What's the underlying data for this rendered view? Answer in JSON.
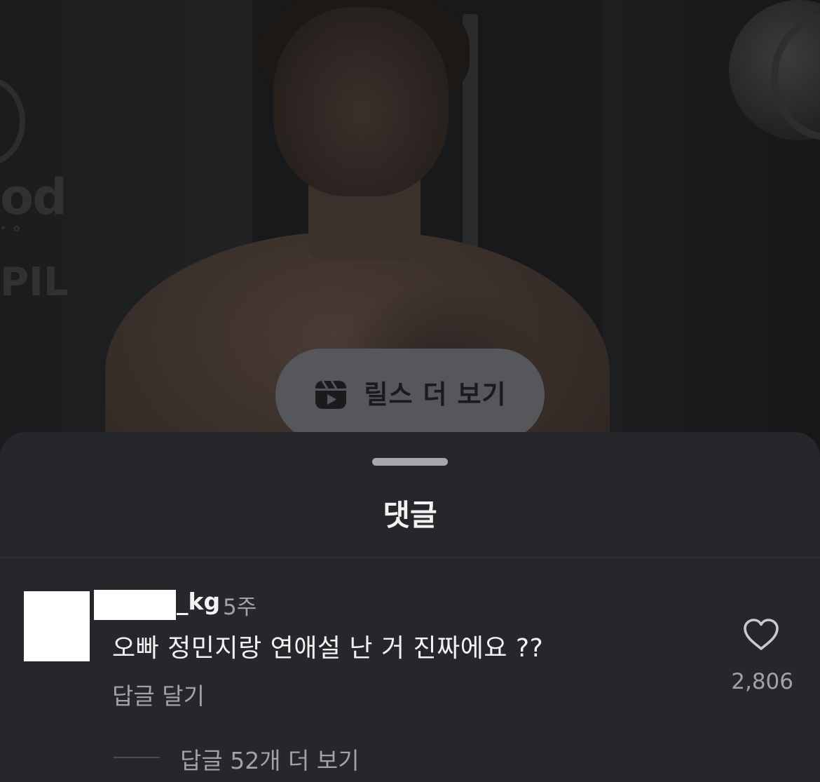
{
  "reels_button": {
    "label": "릴스 더 보기",
    "icon": "reels-icon"
  },
  "sheet": {
    "title": "댓글"
  },
  "comment": {
    "username_visible_suffix": "_kg",
    "time": "5주",
    "text": "오빠 정민지랑 연애설 난 거 진짜에요 ??",
    "reply_label": "답글 달기",
    "like_icon": "heart-icon",
    "like_count": "2,806",
    "view_replies_label": "답글 52개 더 보기"
  },
  "colors": {
    "sheet_background": "#25272b",
    "pill_background": "#56575b",
    "primary_text": "#f2f2f3",
    "secondary_text": "#a0a2a6"
  }
}
